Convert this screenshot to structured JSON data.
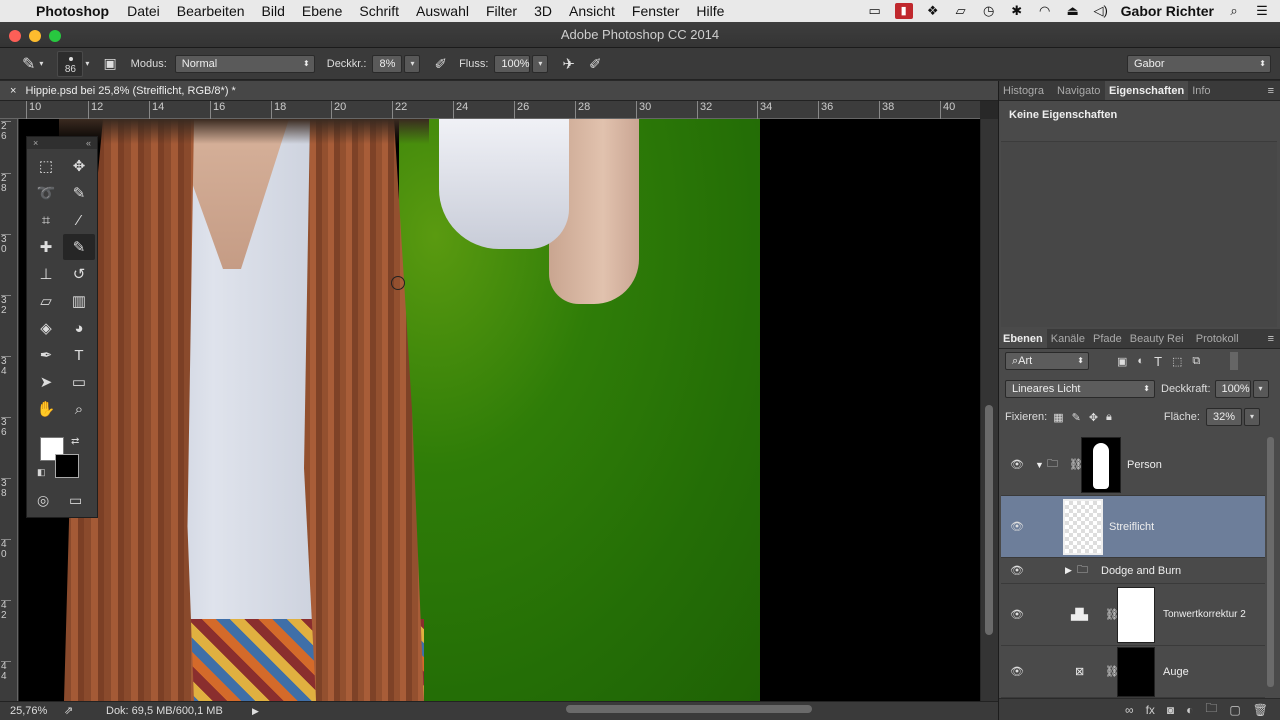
{
  "menubar": {
    "app": "Photoshop",
    "menus": [
      "Datei",
      "Bearbeiten",
      "Bild",
      "Ebene",
      "Schrift",
      "Auswahl",
      "Filter",
      "3D",
      "Ansicht",
      "Fenster",
      "Hilfe"
    ],
    "user": "Gabor Richter"
  },
  "window": {
    "title": "Adobe Photoshop CC 2014"
  },
  "options": {
    "brush_size": "86",
    "mode_label": "Modus:",
    "mode_value": "Normal",
    "opacity_label": "Deckkr.:",
    "opacity_value": "8%",
    "flow_label": "Fluss:",
    "flow_value": "100%",
    "workspace": "Gabor"
  },
  "document": {
    "tab_title": "Hippie.psd bei 25,8% (Streiflicht, RGB/8*) *",
    "ruler_top": [
      "10",
      "12",
      "14",
      "16",
      "18",
      "20",
      "22",
      "24",
      "26",
      "28",
      "30",
      "32",
      "34",
      "36",
      "38",
      "40"
    ],
    "ruler_left": [
      "2\n6",
      "2\n8",
      "3\n0",
      "3\n2",
      "3\n4",
      "3\n6",
      "3\n8",
      "4\n0",
      "4\n2",
      "4\n4"
    ]
  },
  "status": {
    "zoom": "25,76%",
    "doc": "Dok: 69,5 MB/600,1 MB"
  },
  "properties_panel": {
    "tabs": [
      "Histogra",
      "Navigato",
      "Eigenschaften",
      "Info"
    ],
    "active_tab": "Eigenschaften",
    "message": "Keine Eigenschaften"
  },
  "layers_panel": {
    "tabs": [
      "Ebenen",
      "Kanäle",
      "Pfade",
      "Beauty Rei",
      "Protokoll"
    ],
    "filter": "Art",
    "blend_mode": "Lineares Licht",
    "opacity_label": "Deckkraft:",
    "opacity_value": "100%",
    "lock_label": "Fixieren:",
    "fill_label": "Fläche:",
    "fill_value": "32%",
    "layers": [
      {
        "name": "Person",
        "selected": false
      },
      {
        "name": "Streiflicht",
        "selected": true
      },
      {
        "name": "Dodge and Burn",
        "selected": false
      },
      {
        "name": "Tonwertkorrektur 2",
        "selected": false
      },
      {
        "name": "Auge",
        "selected": false
      }
    ]
  }
}
